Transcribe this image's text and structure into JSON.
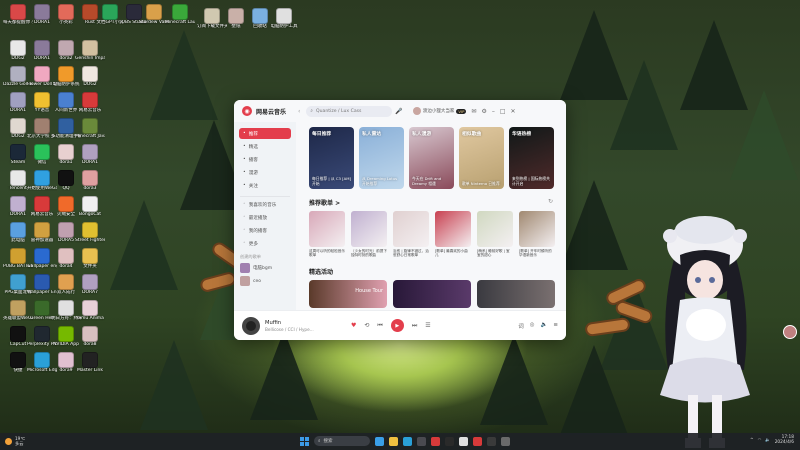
{
  "desktop": {
    "icons": [
      {
        "label": "每天都提醒你 小鸭",
        "color": "#d94848"
      },
      {
        "label": "DORA1",
        "color": "#8a7a9a"
      },
      {
        "label": "小英彩",
        "color": "#e26a5a"
      },
      {
        "label": "Rust",
        "color": "#b84a2a"
      },
      {
        "label": "文档GPT小说",
        "color": "#2aa65a"
      },
      {
        "label": "OBS Studio",
        "color": "#2a2a3a"
      },
      {
        "label": "Stardew Valley",
        "color": "#d9a04a"
      },
      {
        "label": "Minecraft Launcher",
        "color": "#3aa83a"
      },
      {
        "label": "订阅下载文件夹",
        "color": "#d0c8b0"
      },
      {
        "label": "壁纸",
        "color": "#c9b0a8"
      },
      {
        "label": "回收站",
        "color": "#7ab0e0"
      },
      {
        "label": "电脑防护工具",
        "color": "#e0e0e0"
      },
      {
        "label": "DOG2",
        "color": "#e8e8e8"
      },
      {
        "label": "DORA1",
        "color": "#8a7a9a"
      },
      {
        "label": "dora2",
        "color": "#c0a8b0"
      },
      {
        "label": "Genshin Impact Doppler",
        "color": "#d2c0a0"
      },
      {
        "label": "Dazzle Gonner Oyo",
        "color": "#b0b0c0"
      },
      {
        "label": "Flower Doll Studio",
        "color": "#f0a8c0"
      },
      {
        "label": "电脑防护系统",
        "color": "#f09a2a"
      },
      {
        "label": "DOG2",
        "color": "#f0e8e0"
      },
      {
        "label": "DORA1",
        "color": "#a0a0c0"
      },
      {
        "label": "YY语音",
        "color": "#f0c030"
      },
      {
        "label": "人间新世界",
        "color": "#4a80d0"
      },
      {
        "label": "网易云音乐",
        "color": "#d83a3a"
      },
      {
        "label": "DOG2",
        "color": "#e0d8d0"
      },
      {
        "label": "北京大学校 多人",
        "color": "#a08070"
      },
      {
        "label": "多功能清理手册",
        "color": "#3060a0"
      },
      {
        "label": "Minecraft Java Edition",
        "color": "#6a8a3a"
      },
      {
        "label": "Steam",
        "color": "#1b2838"
      },
      {
        "label": "微信",
        "color": "#2ac25a"
      },
      {
        "label": "dora1",
        "color": "#e8d0d0"
      },
      {
        "label": "DORA1",
        "color": "#b0a0c0"
      },
      {
        "label": "Tencent",
        "color": "#e8e8e8"
      },
      {
        "label": "开始使用WeGame",
        "color": "#30a0e0"
      },
      {
        "label": "QQ",
        "color": "#111111"
      },
      {
        "label": "dora3",
        "color": "#e0a0a0"
      },
      {
        "label": "DORA1",
        "color": "#c0b0d0"
      },
      {
        "label": "网易云音乐",
        "color": "#d83a3a"
      },
      {
        "label": "火绒安全",
        "color": "#f06a2a"
      },
      {
        "label": "BongoCat",
        "color": "#f0f0f0"
      },
      {
        "label": "此电脑",
        "color": "#5aa0e0"
      },
      {
        "label": "雷神加速器",
        "color": "#d0a040"
      },
      {
        "label": "DORA5",
        "color": "#c0a0b0"
      },
      {
        "label": "Street Fighter 6",
        "color": "#e0c030"
      },
      {
        "label": "PUBG BATTLEGROUNDS",
        "color": "#d0a030"
      },
      {
        "label": "wallpaper engine",
        "color": "#2a6ad0"
      },
      {
        "label": "dora4",
        "color": "#e0c0c0"
      },
      {
        "label": "文件夹",
        "color": "#e8c050"
      },
      {
        "label": "PPG桌面宠物",
        "color": "#40a0d0"
      },
      {
        "label": "Wallpaper Engine 组件",
        "color": "#2a5ab0"
      },
      {
        "label": "双人成行",
        "color": "#e0a050"
      },
      {
        "label": "DORA7",
        "color": "#b0a0c0"
      },
      {
        "label": "英雄联盟WeGame版",
        "color": "#c0a060"
      },
      {
        "label": "Green Hell",
        "color": "#3a6a2a"
      },
      {
        "label": "明日方舟：终末地",
        "color": "#e0e0e0"
      },
      {
        "label": "Yamu Anima",
        "color": "#e8d0d8"
      },
      {
        "label": "CapCut",
        "color": "#111111"
      },
      {
        "label": "Perplexity Project",
        "color": "#202830"
      },
      {
        "label": "NVIDIA App",
        "color": "#76b900"
      },
      {
        "label": "dora8",
        "color": "#d8c0c0"
      },
      {
        "label": "快捷",
        "color": "#111111"
      },
      {
        "label": "Microsoft Edge",
        "color": "#2aa0d8"
      },
      {
        "label": "dora9",
        "color": "#e0c0d0"
      },
      {
        "label": "Master Link",
        "color": "#222222"
      }
    ]
  },
  "window": {
    "app_title": "网易云音乐",
    "search_placeholder": "Quantize / Lux Cass",
    "user_name": "渡边小狸大当家",
    "vip_badge": "VIP",
    "sidebar": {
      "items": [
        {
          "label": "推荐",
          "active": true
        },
        {
          "label": "精选"
        },
        {
          "label": "播客"
        },
        {
          "label": "漫游"
        },
        {
          "label": "关注"
        }
      ],
      "my_section": [
        {
          "label": "我喜欢的音乐"
        },
        {
          "label": "最近播放"
        },
        {
          "label": "我的播客"
        },
        {
          "label": "更多"
        }
      ],
      "playlist_header": "创建的歌单",
      "playlists": [
        {
          "label": "电脑bgm",
          "color": "#a080b0"
        },
        {
          "label": "ceo",
          "color": "#c0a0a0"
        }
      ]
    },
    "feature_cards": [
      {
        "title": "每日推荐",
        "sub": "每日推荐 | 从 C3 [AM] 开始",
        "color1": "#1e2848",
        "color2": "#3a4a78"
      },
      {
        "title": "私人雷达",
        "sub": "从 Dreaming Lotus 开始推荐",
        "color1": "#8ab0d8",
        "color2": "#c0d8ec"
      },
      {
        "title": "私人漫游",
        "sub": "今天在 Drift and Dreamy 相遇",
        "color1": "#d8c8d0",
        "color2": "#8a4a5a"
      },
      {
        "title": "相似歌曲",
        "sub": "歌单 Ninterno 已推荐",
        "color1": "#e0c8a0",
        "color2": "#b8a070"
      },
      {
        "title": "华语热榜",
        "sub": "来到热榜 | 国际热榜共计开启",
        "color1": "#101818",
        "color2": "#502a2a"
      }
    ],
    "recommend_title": "推荐歌单",
    "recommend_arrow": ">",
    "refresh_icon_label": "↻",
    "playlists": [
      {
        "name": "这周可以听的轻松音乐歌单",
        "color": "#d8a8b8"
      },
      {
        "name": "〔少女的时光〕前提下独特时刻的歌曲",
        "color": "#c0b0d0"
      },
      {
        "name": "治愈 | 旋律不错过，治愈舒心日常歌单",
        "color": "#e0d0d0"
      },
      {
        "name": "[歌单] 最喜欢的小曲儿",
        "color": "#c84050"
      },
      {
        "name": "[萌系] 睡前好歌 | 宝宝的甜心",
        "color": "#d0d8c0"
      },
      {
        "name": "[歌单] 开车时候听的华语新音乐",
        "color": "#a08870"
      }
    ],
    "activity_title": "精选活动",
    "activities": [
      {
        "text": "House Tour",
        "color1": "#5a3a2a",
        "color2": "#e0a0b0"
      },
      {
        "text": "",
        "color1": "#281838",
        "color2": "#5a3a6a"
      },
      {
        "text": "",
        "color1": "#3a3a40",
        "color2": "#7a7070"
      }
    ],
    "player": {
      "song_title": "Muffin",
      "song_artist": "Bellicose / CCI / Hype...",
      "like_icon": "♥",
      "prev_icon": "⏮",
      "play_icon": "▶",
      "next_icon": "⏭",
      "mode_icon": "⟲",
      "list_icon": "☰"
    }
  },
  "taskbar": {
    "weather_temp": "19℃",
    "weather_desc": "多云",
    "search_label": "搜索",
    "time": "17:18",
    "date": "2024/4/6",
    "apps": [
      {
        "color": "#3a9fe8"
      },
      {
        "color": "#f0c040"
      },
      {
        "color": "#2aa0d8"
      },
      {
        "color": "#4a4a50"
      },
      {
        "color": "#d83a3a"
      },
      {
        "color": "#2a2a2a"
      },
      {
        "color": "#e0e0e0"
      },
      {
        "color": "#d83a3a"
      },
      {
        "color": "#3a3a3a"
      },
      {
        "color": "#6a6a6a"
      }
    ]
  }
}
